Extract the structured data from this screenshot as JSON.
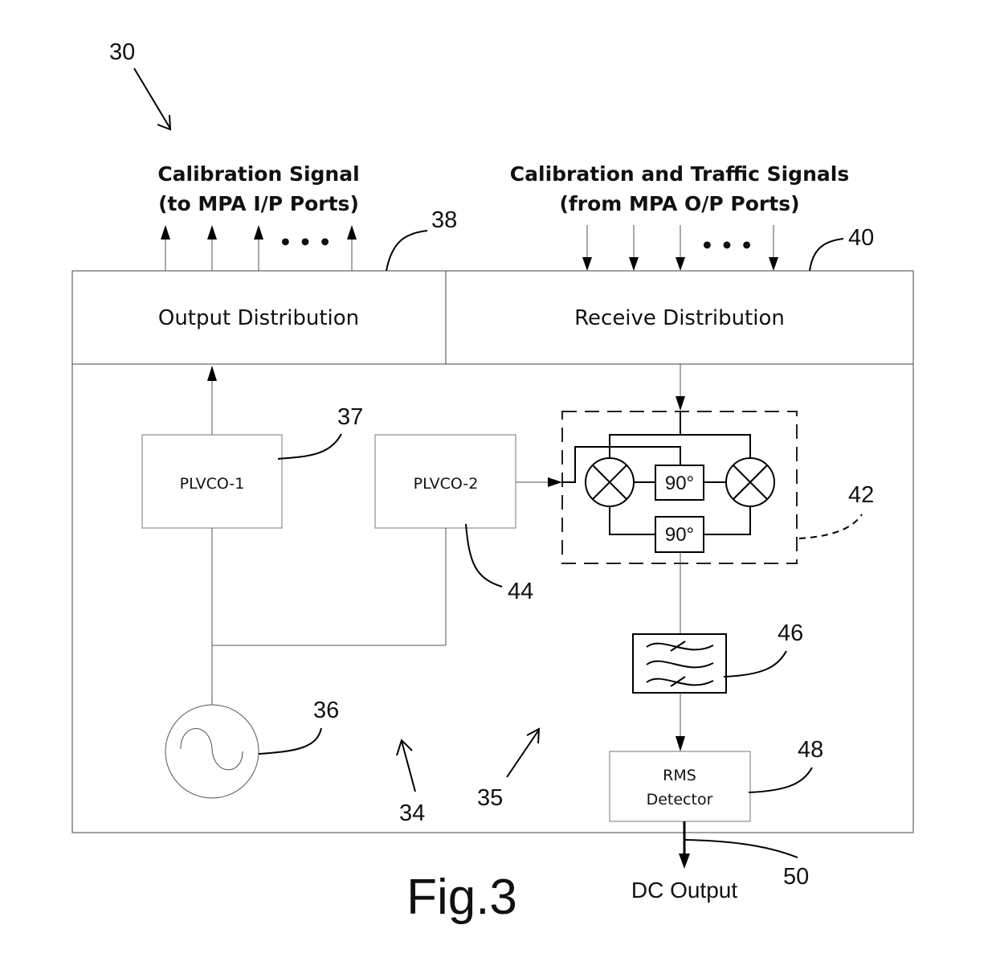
{
  "figure": {
    "caption": "Fig.3",
    "system_ref": "30"
  },
  "inputs_label": {
    "line1": "Calibration Signal",
    "line2": "(to MPA I/P Ports)"
  },
  "outputs_label": {
    "line1": "Calibration and Traffic Signals",
    "line2": "(from MPA O/P Ports)"
  },
  "blocks": {
    "output_distribution": {
      "label": "Output Distribution",
      "ref": "38"
    },
    "receive_distribution": {
      "label": "Receive Distribution",
      "ref": "40"
    },
    "plvco1": {
      "label": "PLVCO-1",
      "ref": "37"
    },
    "plvco2": {
      "label": "PLVCO-2",
      "ref": "44"
    },
    "mixer_network": {
      "ref": "42",
      "phase_shifter_top": "90°",
      "phase_shifter_bottom": "90°"
    },
    "oscillator": {
      "ref": "36"
    },
    "filter": {
      "ref": "46"
    },
    "rms_detector": {
      "line1": "RMS",
      "line2": "Detector",
      "ref": "48"
    },
    "dc_output": {
      "label": "DC Output",
      "ref": "50"
    }
  },
  "refs": {
    "transmit_section": "34",
    "receive_section": "35"
  },
  "ellipsis": "• • •"
}
